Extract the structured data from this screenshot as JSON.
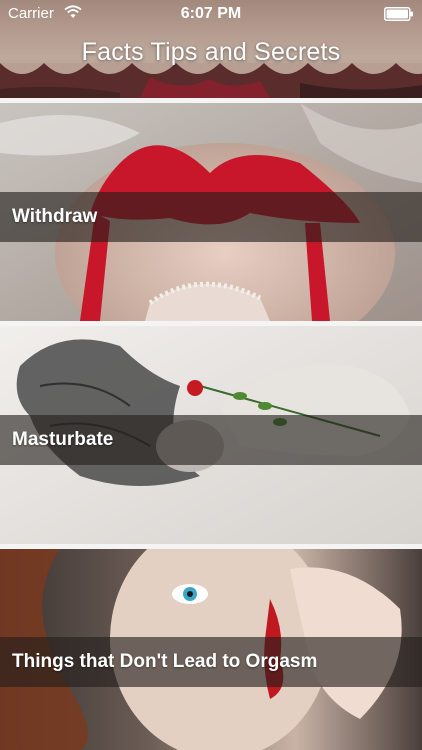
{
  "status_bar": {
    "carrier": "Carrier",
    "time": "6:07 PM"
  },
  "header": {
    "title": "Facts Tips and Secrets"
  },
  "items": [
    {
      "label": "Withdraw"
    },
    {
      "label": "Masturbate"
    },
    {
      "label": "Things that Don't Lead to Orgasm"
    }
  ]
}
